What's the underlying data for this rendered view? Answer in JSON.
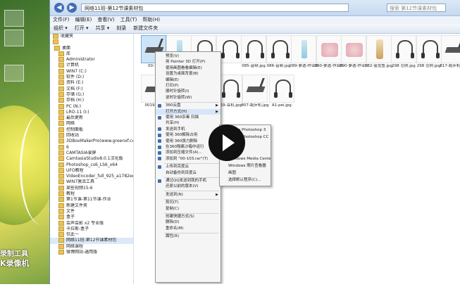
{
  "window": {
    "address": "网络11班-第12节课素材包",
    "search_placeholder": "搜索 第12节课素材包",
    "menu": [
      "文件(F)",
      "编辑(E)",
      "查看(V)",
      "工具(T)",
      "帮助(H)"
    ],
    "toolbar": [
      "组织 ▾",
      "打开 ▾",
      "共享 ▾",
      "刻录",
      "新建文件夹"
    ]
  },
  "desktop_overlay": {
    "line1": "录制工具",
    "line2": "K录像机"
  },
  "sidebar": {
    "items": [
      "收藏夹",
      "",
      "桌面",
      "库",
      "Administrator",
      "计算机",
      "WIN7 (C:)",
      "软件 (D:)",
      "资料 (E:)",
      "文档 (F:)",
      "存储 (G:)",
      "存档 (H:)",
      "PC (N:)",
      "LRO-11 (I:)",
      "最后更新",
      "网络",
      "控制面板",
      "回收站",
      "3DBoxMakerPro(www.greenxf.com)",
      "6",
      "CAMTASIA录屏",
      "CamtasiaStudio8.0.1汉化版",
      "Photoshop_cs6_LS6_x64",
      "UFO教程",
      "VideoEncoder_full_925_a1782edf",
      "WIN7激活工具",
      "某些视频15-6",
      "教程",
      "第1节课-第11节课-作业",
      "新建文件夹",
      "文件",
      "盒子",
      "会声会影 x2 专业版",
      "卡拉斯-盒子",
      "仅此一",
      "网络11班-第12节课素材包",
      "网络课程",
      "微博网站-通用版"
    ],
    "selected_index": 35
  },
  "files": [
    {
      "label": "00-10",
      "kind": "tread"
    },
    {
      "label": "",
      "kind": "bottle"
    },
    {
      "label": "",
      "kind": "hp"
    },
    {
      "label": "",
      "kind": "hp"
    },
    {
      "label": "085-音频.jpg",
      "kind": "hp"
    },
    {
      "label": "086-音频.jpg",
      "kind": "hp"
    },
    {
      "label": "089-萝选-作业002.jpg",
      "kind": "bottle"
    },
    {
      "label": "090-萝选-作业001.jpg",
      "kind": "cos"
    },
    {
      "label": "090-萝选-作业002.jpg",
      "kind": "cos"
    },
    {
      "label": "182-金龙鱼.jpg",
      "kind": "gold"
    },
    {
      "label": "298 范例.jpg",
      "kind": "hp"
    },
    {
      "label": "298 范例.jpg",
      "kind": "hp"
    },
    {
      "label": "817-跑步机.jpg",
      "kind": "tread"
    },
    {
      "label": "0019跑步",
      "kind": "tread"
    },
    {
      "label": "",
      "kind": "hp"
    },
    {
      "label": "",
      "kind": "hp"
    },
    {
      "label": "159-耳机.jpg",
      "kind": "hp"
    },
    {
      "label": "807-跑步机.jpg",
      "kind": "tread"
    },
    {
      "label": "A1-pei.jpg",
      "kind": "hp"
    }
  ],
  "context_menu": {
    "items": [
      {
        "label": "预览(V)"
      },
      {
        "label": "用 Painter 3D 打开(P)"
      },
      {
        "label": "使用画图看看编辑(E)"
      },
      {
        "label": "设置为桌面背景(B)"
      },
      {
        "label": "编辑(E)"
      },
      {
        "label": "打印(P)"
      },
      {
        "label": "顺时针旋转(I)"
      },
      {
        "label": "逆时针旋转(W)"
      },
      {
        "sep": true
      },
      {
        "label": "360云盘",
        "arrow": true,
        "icon": true
      },
      {
        "label": "打开方式(H)",
        "arrow": true,
        "hl": true
      },
      {
        "label": "使用 360杀毒 扫描",
        "icon": true
      },
      {
        "label": "共享(H)"
      },
      {
        "label": "发送到手机",
        "icon": true
      },
      {
        "label": "使用 360解除占用",
        "icon": true
      },
      {
        "label": "使用 360强力删除",
        "icon": true
      },
      {
        "label": "在360隔离沙箱中运行",
        "icon": true
      },
      {
        "label": "添加到压缩文件(A)...",
        "icon": true
      },
      {
        "label": "添加到 \"00-103.rar\"(T)",
        "icon": true
      },
      {
        "sep": true
      },
      {
        "label": "上传到百度云",
        "icon": true
      },
      {
        "label": "自动备份到百度云"
      },
      {
        "sep": true
      },
      {
        "label": "通过QQ发送到我的手机",
        "icon": true
      },
      {
        "label": "还原以前的版本(V)"
      },
      {
        "sep": true
      },
      {
        "label": "发送到(N)",
        "arrow": true
      },
      {
        "sep": true
      },
      {
        "label": "剪切(T)"
      },
      {
        "label": "复制(C)"
      },
      {
        "sep": true
      },
      {
        "label": "创建快捷方式(S)"
      },
      {
        "label": "删除(D)"
      },
      {
        "label": "重命名(M)"
      },
      {
        "sep": true
      },
      {
        "label": "属性(R)"
      }
    ]
  },
  "submenu": {
    "items": [
      "Adobe Photoshop 3",
      "Adobe Photoshop CC",
      "",
      "",
      "Windows Media Center",
      "Windows 照片查看器",
      "画图",
      "选择默认程序(C)..."
    ]
  },
  "player": {
    "label": "play"
  }
}
